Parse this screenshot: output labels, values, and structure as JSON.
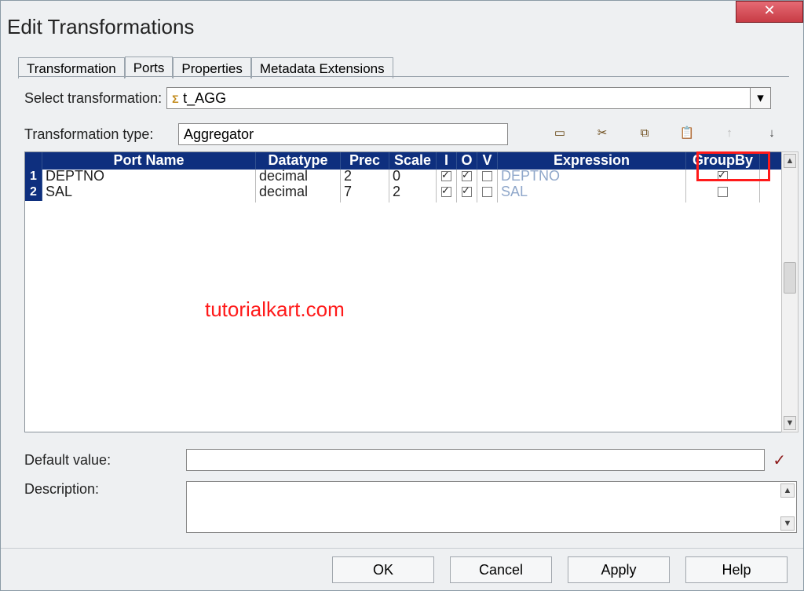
{
  "window": {
    "title": "Edit Transformations",
    "close_glyph": "✕"
  },
  "tabs": [
    {
      "label": "Transformation"
    },
    {
      "label": "Ports",
      "active": true
    },
    {
      "label": "Properties"
    },
    {
      "label": "Metadata Extensions"
    }
  ],
  "select_transformation": {
    "label": "Select transformation:",
    "icon_text": "Σ",
    "value": "t_AGG"
  },
  "transformation_type": {
    "label": "Transformation type:",
    "value": "Aggregator"
  },
  "toolbar_icons": [
    "new-port-icon",
    "cut-icon",
    "copy-icon",
    "paste-icon",
    "move-up-icon",
    "move-down-icon"
  ],
  "grid": {
    "columns": [
      "Port Name",
      "Datatype",
      "Prec",
      "Scale",
      "I",
      "O",
      "V",
      "Expression",
      "GroupBy"
    ],
    "rows": [
      {
        "num": "1",
        "port": "DEPTNO",
        "dtype": "decimal",
        "prec": "2",
        "scale": "0",
        "i": true,
        "o": true,
        "v": false,
        "expr": "DEPTNO",
        "group": true
      },
      {
        "num": "2",
        "port": "SAL",
        "dtype": "decimal",
        "prec": "7",
        "scale": "2",
        "i": true,
        "o": true,
        "v": false,
        "expr": "SAL",
        "group": false
      }
    ]
  },
  "watermark": "tutorialkart.com",
  "default_value": {
    "label": "Default value:",
    "value": ""
  },
  "description": {
    "label": "Description:",
    "value": ""
  },
  "buttons": {
    "ok": "OK",
    "cancel": "Cancel",
    "apply": "Apply",
    "help": "Help"
  }
}
